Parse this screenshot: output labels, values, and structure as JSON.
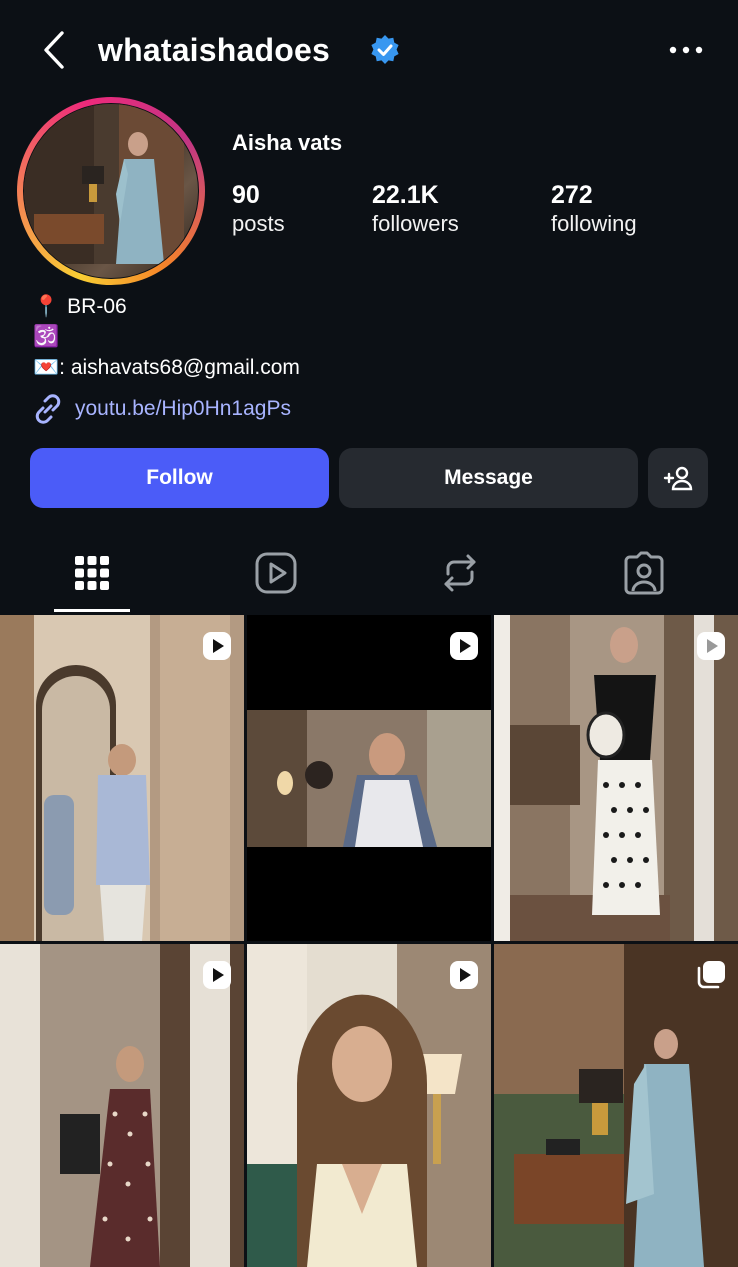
{
  "header": {
    "username": "whataishadoes",
    "verified": true,
    "icons": {
      "back": "chevron-left-icon",
      "verified": "verified-badge-icon",
      "more": "more-horizontal-icon"
    }
  },
  "profile": {
    "full_name": "Aisha vats",
    "stats": [
      {
        "value": "90",
        "label": "posts"
      },
      {
        "value": "22.1K",
        "label": "followers"
      },
      {
        "value": "272",
        "label": "following"
      }
    ]
  },
  "bio": {
    "location_emoji": "📍",
    "location": "BR-06",
    "symbol": "🕉️",
    "email_emoji": "💌",
    "email": ": aishavats68@gmail.com",
    "link": "youtu.be/Hip0Hn1agPs"
  },
  "actions": {
    "follow": "Follow",
    "message": "Message",
    "suggest_icon": "add-person-icon"
  },
  "tabs": [
    {
      "name": "grid",
      "icon": "grid-icon",
      "active": true
    },
    {
      "name": "reels",
      "icon": "reels-icon",
      "active": false
    },
    {
      "name": "reposts",
      "icon": "repost-icon",
      "active": false
    },
    {
      "name": "tagged",
      "icon": "tagged-icon",
      "active": false
    }
  ],
  "posts": [
    {
      "badge": "reel-icon"
    },
    {
      "badge": "reel-icon"
    },
    {
      "badge": "reel-icon"
    },
    {
      "badge": "reel-icon"
    },
    {
      "badge": "reel-icon"
    },
    {
      "badge": "carousel-icon"
    }
  ],
  "colors": {
    "background": "#0c1015",
    "follow_button": "#4b5cf8",
    "secondary_button": "#262a30",
    "link": "#a8b4ff",
    "verified": "#3897f0"
  }
}
